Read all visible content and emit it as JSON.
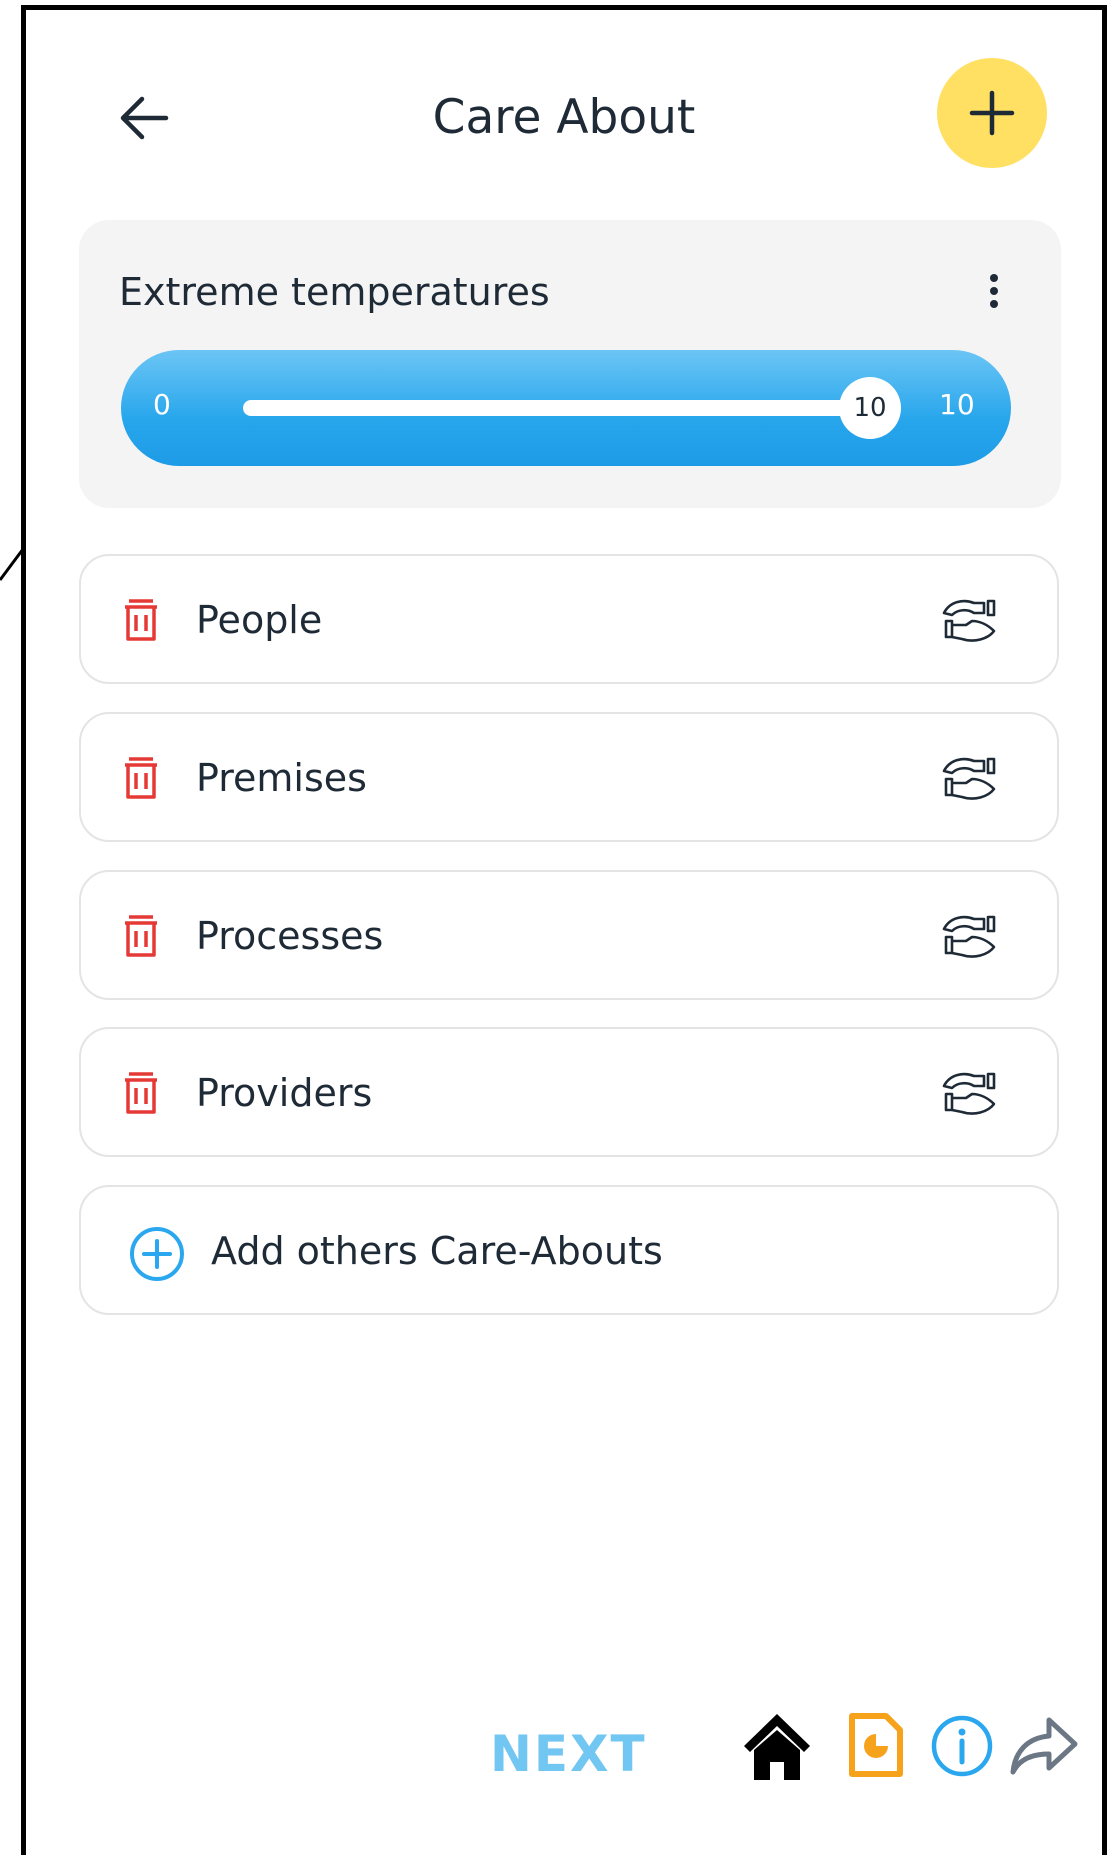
{
  "header": {
    "title": "Care About"
  },
  "temperature_card": {
    "title": "Extreme temperatures",
    "slider": {
      "min_label": "0",
      "max_label": "10",
      "value_label": "10",
      "min": 0,
      "max": 10,
      "value": 10
    }
  },
  "care_abouts": [
    {
      "label": "People"
    },
    {
      "label": "Premises"
    },
    {
      "label": "Processes"
    },
    {
      "label": "Providers"
    }
  ],
  "add_others": {
    "label": "Add others Care-Abouts"
  },
  "footer": {
    "next_label": "NEXT"
  },
  "colors": {
    "accent_yellow": "#ffe062",
    "slider_blue": "#27a6ec",
    "trash_red": "#e53935",
    "next_blue": "#72c6f2",
    "doc_orange": "#f7a21b",
    "info_blue": "#2aa7ef"
  },
  "icons": {
    "back": "arrow-left-icon",
    "add": "plus-icon",
    "menu": "kebab-menu-icon",
    "delete": "trash-icon",
    "care": "caring-hands-icon",
    "add_circle": "plus-circle-icon",
    "home": "home-icon",
    "report": "report-icon",
    "info": "info-icon",
    "share": "share-arrow-icon"
  }
}
